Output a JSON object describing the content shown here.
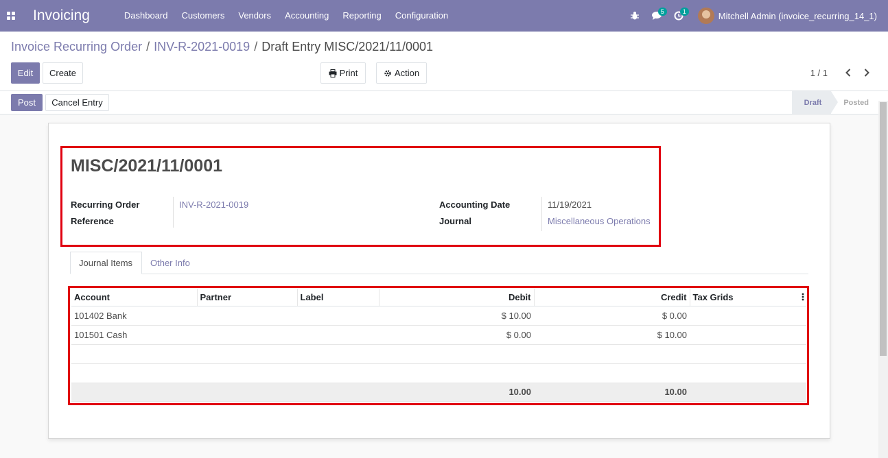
{
  "navbar": {
    "app_name": "Invoicing",
    "menu": [
      "Dashboard",
      "Customers",
      "Vendors",
      "Accounting",
      "Reporting",
      "Configuration"
    ],
    "messages_badge": "5",
    "activities_badge": "1",
    "user": "Mitchell Admin (invoice_recurring_14_1)"
  },
  "breadcrumb": {
    "root": "Invoice Recurring Order",
    "parent": "INV-R-2021-0019",
    "current": "Draft Entry MISC/2021/11/0001",
    "separator": "/"
  },
  "control": {
    "edit": "Edit",
    "create": "Create",
    "print": "Print",
    "action": "Action",
    "pager": "1 / 1"
  },
  "statusbar": {
    "post": "Post",
    "cancel_entry": "Cancel Entry",
    "steps": [
      "Draft",
      "Posted"
    ],
    "active_step": "Draft"
  },
  "form": {
    "title": "MISC/2021/11/0001",
    "recurring_order_label": "Recurring Order",
    "recurring_order_value": "INV-R-2021-0019",
    "reference_label": "Reference",
    "reference_value": "",
    "accounting_date_label": "Accounting Date",
    "accounting_date_value": "11/19/2021",
    "journal_label": "Journal",
    "journal_value": "Miscellaneous Operations"
  },
  "tabs": [
    "Journal Items",
    "Other Info"
  ],
  "journal_items": {
    "headers": [
      "Account",
      "Partner",
      "Label",
      "Debit",
      "Credit",
      "Tax Grids"
    ],
    "rows": [
      {
        "account": "101402 Bank",
        "partner": "",
        "label": "",
        "debit": "$ 10.00",
        "credit": "$ 0.00",
        "tax_grids": ""
      },
      {
        "account": "101501 Cash",
        "partner": "",
        "label": "",
        "debit": "$ 0.00",
        "credit": "$ 10.00",
        "tax_grids": ""
      }
    ],
    "total_debit": "10.00",
    "total_credit": "10.00"
  },
  "colors": {
    "brand": "#7c7bad",
    "highlight_box": "#e0000f"
  }
}
